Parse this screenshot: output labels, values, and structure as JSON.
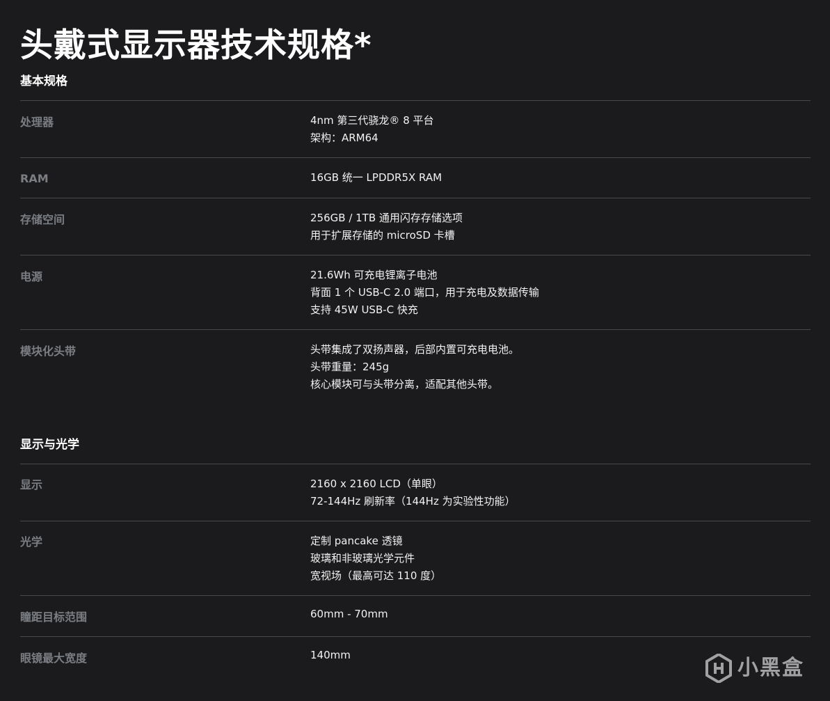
{
  "page": {
    "title": "头戴式显示器技术规格*"
  },
  "sections": [
    {
      "heading": "基本规格",
      "rows": [
        {
          "label": "处理器",
          "values": [
            "4nm 第三代骁龙® 8 平台",
            "架构：ARM64"
          ]
        },
        {
          "label": "RAM",
          "values": [
            "16GB 统一 LPDDR5X RAM"
          ]
        },
        {
          "label": "存储空间",
          "values": [
            "256GB / 1TB 通用闪存存储选项",
            "用于扩展存储的 microSD 卡槽"
          ]
        },
        {
          "label": "电源",
          "values": [
            "21.6Wh 可充电锂离子电池",
            "背面 1 个 USB-C 2.0 端口，用于充电及数据传输",
            "支持 45W USB-C 快充"
          ]
        },
        {
          "label": "模块化头带",
          "values": [
            "头带集成了双扬声器，后部内置可充电电池。",
            "头带重量：245g",
            "核心模块可与头带分离，适配其他头带。"
          ]
        }
      ]
    },
    {
      "heading": "显示与光学",
      "rows": [
        {
          "label": "显示",
          "values": [
            "2160 x 2160 LCD（单眼）",
            "72-144Hz 刷新率（144Hz 为实验性功能）"
          ]
        },
        {
          "label": "光学",
          "values": [
            "定制 pancake 透镜",
            "玻璃和非玻璃光学元件",
            "宽视场（最高可达 110 度）"
          ]
        },
        {
          "label": "瞳距目标范围",
          "values": [
            "60mm - 70mm"
          ]
        },
        {
          "label": "眼镜最大宽度",
          "values": [
            "140mm"
          ]
        }
      ]
    }
  ],
  "watermark": {
    "text": "小黑盒",
    "icon": "xiaoheihe-logo-icon"
  },
  "colors": {
    "background": "#1b1b1d",
    "label": "#7a7d82",
    "value": "#f2f2f2",
    "divider": "#4a4a4d"
  }
}
